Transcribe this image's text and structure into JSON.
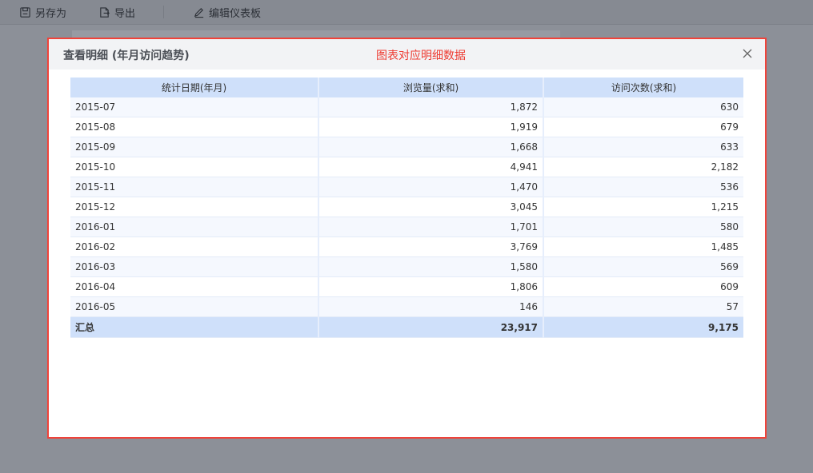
{
  "toolbar": {
    "save_as": "另存为",
    "export": "导出",
    "edit_dashboard": "编辑仪表板"
  },
  "modal": {
    "title": "查看明细 (年月访问趋势)",
    "annotation": "图表对应明细数据",
    "annotation_color": "#ee3b31",
    "border_color": "#f0433a"
  },
  "table": {
    "headers": [
      "统计日期(年月)",
      "浏览量(求和)",
      "访问次数(求和)"
    ],
    "rows": [
      [
        "2015-07",
        "1,872",
        "630"
      ],
      [
        "2015-08",
        "1,919",
        "679"
      ],
      [
        "2015-09",
        "1,668",
        "633"
      ],
      [
        "2015-10",
        "4,941",
        "2,182"
      ],
      [
        "2015-11",
        "1,470",
        "536"
      ],
      [
        "2015-12",
        "3,045",
        "1,215"
      ],
      [
        "2016-01",
        "1,701",
        "580"
      ],
      [
        "2016-02",
        "3,769",
        "1,485"
      ],
      [
        "2016-03",
        "1,580",
        "569"
      ],
      [
        "2016-04",
        "1,806",
        "609"
      ],
      [
        "2016-05",
        "146",
        "57"
      ]
    ],
    "total": [
      "汇总",
      "23,917",
      "9,175"
    ]
  }
}
